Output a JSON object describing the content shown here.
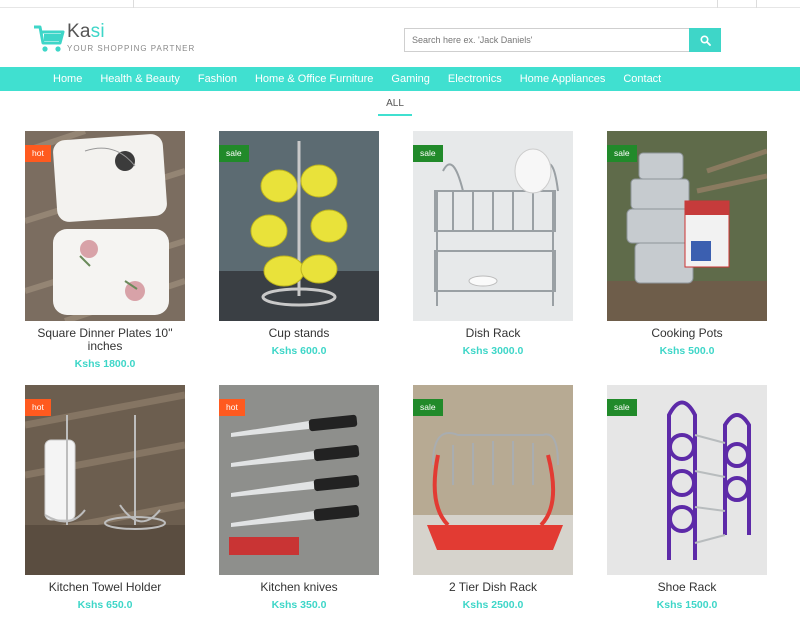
{
  "brand": {
    "name_main": "Ka",
    "name_accent": "si",
    "tagline": "YOUR SHOPPING PARTNER",
    "accent_color": "#3ed6c8",
    "logo_icon": "shopping-cart-icon"
  },
  "search": {
    "placeholder": "Search here ex. 'Jack Daniels'",
    "value": "",
    "button_icon": "search-icon"
  },
  "nav": {
    "color": "#40e0d0",
    "items": [
      {
        "label": "Home"
      },
      {
        "label": "Health & Beauty"
      },
      {
        "label": "Fashion"
      },
      {
        "label": "Home & Office Furniture"
      },
      {
        "label": "Gaming"
      },
      {
        "label": "Electronics"
      },
      {
        "label": "Home Appliances"
      },
      {
        "label": "Contact"
      }
    ]
  },
  "filter": {
    "active": "ALL"
  },
  "products": [
    {
      "name": "Square Dinner Plates 10'' inches",
      "price": "Kshs 1800.0",
      "badge": "hot"
    },
    {
      "name": "Cup stands",
      "price": "Kshs 600.0",
      "badge": "sale"
    },
    {
      "name": "Dish Rack",
      "price": "Kshs 3000.0",
      "badge": "sale"
    },
    {
      "name": "Cooking Pots",
      "price": "Kshs 500.0",
      "badge": "sale"
    },
    {
      "name": "Kitchen Towel Holder",
      "price": "Kshs 650.0",
      "badge": "hot"
    },
    {
      "name": "Kitchen knives",
      "price": "Kshs 350.0",
      "badge": "hot"
    },
    {
      "name": "2 Tier Dish Rack",
      "price": "Kshs 2500.0",
      "badge": "sale"
    },
    {
      "name": "Shoe Rack",
      "price": "Kshs 1500.0",
      "badge": "sale"
    }
  ]
}
